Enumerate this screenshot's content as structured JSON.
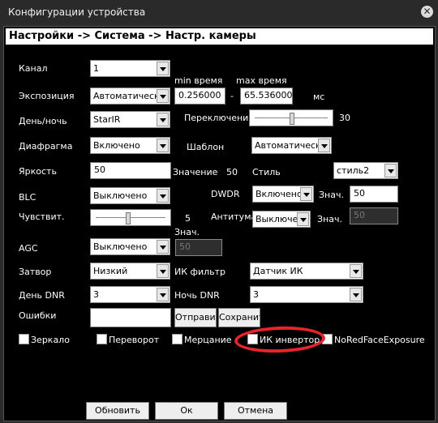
{
  "window": {
    "title": "Конфигурации устройства"
  },
  "header": "Настройки -> Система -> Настр. камеры",
  "channel": {
    "label": "Канал",
    "value": "1"
  },
  "exposure": {
    "label": "Экспозиция",
    "value": "Автоматически",
    "min_label": "min время",
    "max_label": "max время",
    "min_value": "0.256000",
    "dash": "-",
    "max_value": "65.536000",
    "unit": "мс"
  },
  "daynight": {
    "label": "День/ночь",
    "value": "StarIR",
    "switch_label": "Переключение",
    "switch_value": "30",
    "switch_level_fraction": 0.5
  },
  "iris": {
    "label": "Диафрагма",
    "value": "Включено",
    "template_label": "Шаблон",
    "template_value": "Автоматически"
  },
  "brightness": {
    "label": "Яркость",
    "value": "50",
    "value_label": "Значение",
    "value_num": "50",
    "style_label": "Стиль",
    "style_value": "стиль2"
  },
  "blc": {
    "label": "BLC",
    "value": "Выключено",
    "dwdr_label": "DWDR",
    "dwdr_value": "Включено",
    "znach_label": "Знач.",
    "znach_value": "50"
  },
  "sensitivity": {
    "label": "Чувствит.",
    "value": "5",
    "level_fraction": 0.45,
    "antitum_label": "Антитума",
    "antitum_value": "Выключено",
    "znach_label": "Знач.",
    "znach_value": "50"
  },
  "agc": {
    "label": "AGC",
    "value": "Выключено",
    "znach_label": "Знач.",
    "znach_value": "50"
  },
  "shutter": {
    "label": "Затвор",
    "value": "Низкий",
    "ir_filter_label": "ИК фильтр",
    "ir_filter_value": "Датчик ИК"
  },
  "day_dnr": {
    "label": "День DNR",
    "value": "3",
    "night_label": "Ночь DNR",
    "night_value": "3"
  },
  "errors": {
    "label": "Ошибки",
    "value": "",
    "send_label": "Отправить",
    "save_label": "Сохранить"
  },
  "checkboxes": {
    "mirror": "Зеркало",
    "flip": "Переворот",
    "flicker": "Мерцание",
    "ir_invert": "ИК инвертор",
    "no_red_face": "NoRedFaceExposure"
  },
  "buttons": {
    "refresh": "Обновить",
    "ok": "Ок",
    "cancel": "Отмена"
  },
  "colors": {
    "highlight_circle": "#e8232a"
  }
}
